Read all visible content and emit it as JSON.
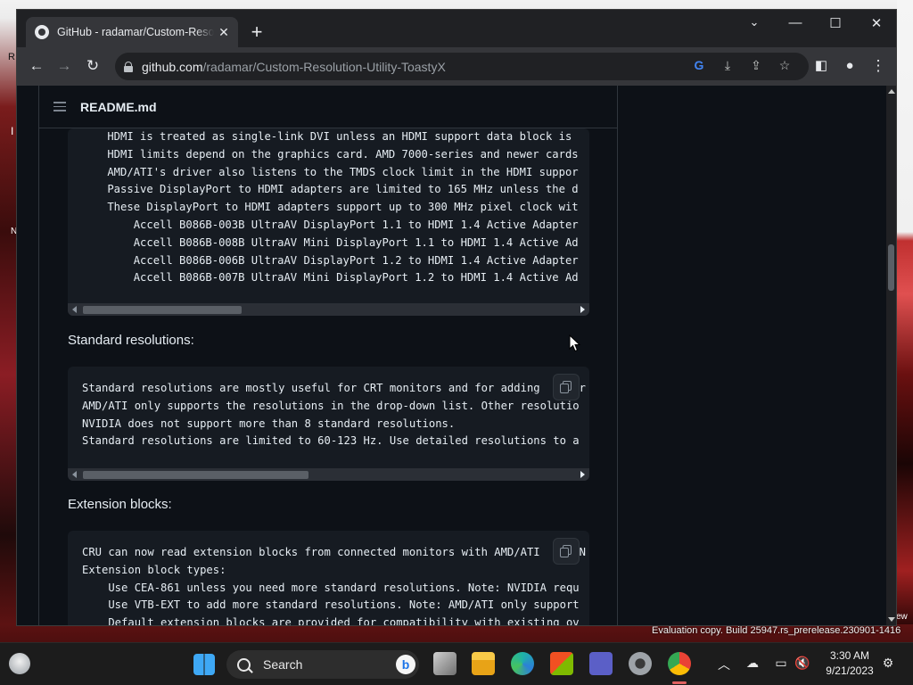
{
  "desktop": {
    "left_labels": [
      "R",
      "I",
      "N"
    ],
    "right_label": "ew"
  },
  "browser": {
    "tab_title": "GitHub - radamar/Custom-Resolution-Utility-ToastyX",
    "url_host": "github.com",
    "url_path": "/radamar/Custom-Resolution-Utility-ToastyX"
  },
  "readme": {
    "title": "README.md",
    "block1_lines": [
      "    HDMI is treated as single-link DVI unless an HDMI support data block is",
      "    HDMI limits depend on the graphics card. AMD 7000-series and newer cards",
      "    AMD/ATI's driver also listens to the TMDS clock limit in the HDMI suppor",
      "    Passive DisplayPort to HDMI adapters are limited to 165 MHz unless the d",
      "    These DisplayPort to HDMI adapters support up to 300 MHz pixel clock wit",
      "        Accell B086B-003B UltraAV DisplayPort 1.1 to HDMI 1.4 Active Adapter",
      "        Accell B086B-008B UltraAV Mini DisplayPort 1.1 to HDMI 1.4 Active Ad",
      "        Accell B086B-006B UltraAV DisplayPort 1.2 to HDMI 1.4 Active Adapter",
      "        Accell B086B-007B UltraAV Mini DisplayPort 1.2 to HDMI 1.4 Active Ad"
    ],
    "heading_standard": "Standard resolutions:",
    "block2_lines": [
      "Standard resolutions are mostly useful for CRT monitors and for adding      r",
      "AMD/ATI only supports the resolutions in the drop-down list. Other resolutio",
      "NVIDIA does not support more than 8 standard resolutions.",
      "Standard resolutions are limited to 60-123 Hz. Use detailed resolutions to a"
    ],
    "heading_extension": "Extension blocks:",
    "block3_lines": [
      "CRU can now read extension blocks from connected monitors with AMD/ATI      N",
      "Extension block types:",
      "    Use CEA-861 unless you need more standard resolutions. Note: NVIDIA requ",
      "    Use VTB-EXT to add more standard resolutions. Note: AMD/ATI only support",
      "    Default extension blocks are provided for compatibility with existing ov"
    ]
  },
  "watermark": "Evaluation copy. Build 25947.rs_prerelease.230901-1416",
  "taskbar": {
    "search_label": "Search",
    "bing_label": "b",
    "clock_time": "3:30 AM",
    "clock_date": "9/21/2023"
  },
  "colors": {
    "github_bg": "#0d1117",
    "code_bg": "#161b22",
    "chrome_dark": "#202124",
    "chrome_toolbar": "#35363a"
  }
}
